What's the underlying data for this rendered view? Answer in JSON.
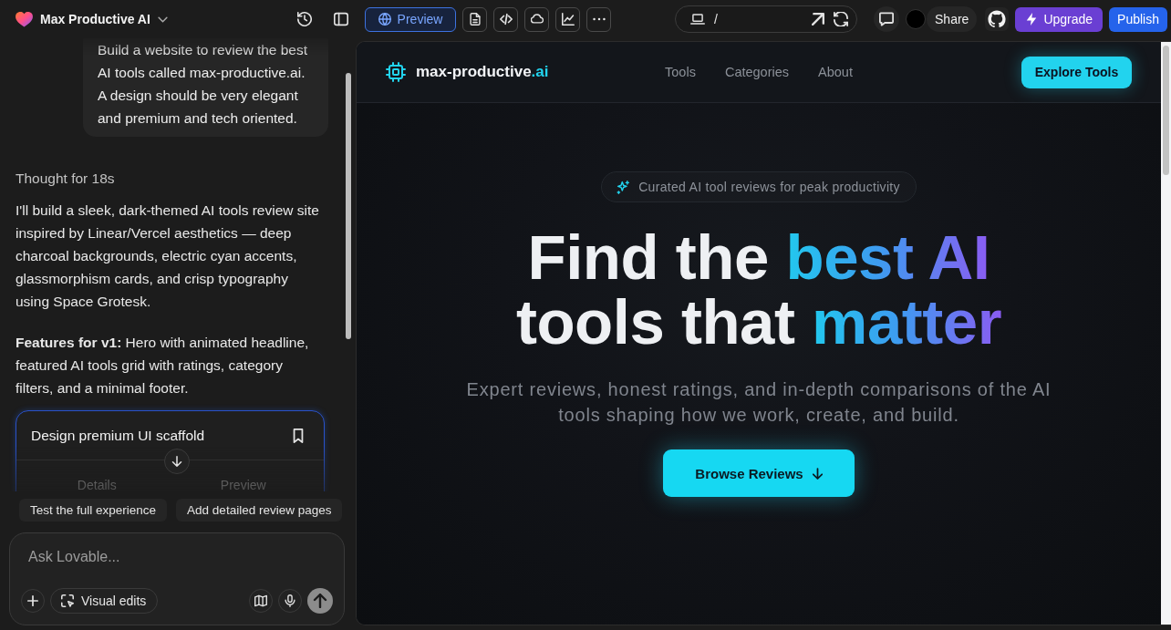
{
  "project": {
    "name": "Max Productive AI"
  },
  "toolbar": {
    "views": [
      {
        "kind": "preview",
        "label": "Preview",
        "selected": true
      },
      {
        "kind": "file",
        "selected": false
      },
      {
        "kind": "code",
        "selected": false
      },
      {
        "kind": "cloud",
        "selected": false
      },
      {
        "kind": "analytics",
        "selected": false
      },
      {
        "kind": "more",
        "selected": false
      }
    ]
  },
  "address_bar": {
    "path": "/"
  },
  "actions": {
    "share": "Share",
    "upgrade": "Upgrade",
    "publish": "Publish"
  },
  "chat": {
    "user_message": "Build a website to review the best AI tools called max-productive.ai. A design should be very elegant and premium and tech oriented.",
    "thought": "Thought for 18s",
    "paragraphs": [
      "I'll build a sleek, dark-themed AI tools review site inspired by Linear/Vercel aesthetics — deep charcoal backgrounds, electric cyan accents, glassmorphism cards, and crisp typography using Space Grotesk.",
      "**Features for v1:** Hero with animated headline, featured AI tools grid with ratings, category filters, and a minimal footer."
    ],
    "plan_card": {
      "title": "Design premium UI scaffold",
      "tabs": [
        "Details",
        "Preview"
      ]
    },
    "suggestions": [
      "Test the full experience",
      "Add detailed review pages"
    ],
    "composer": {
      "placeholder": "Ask Lovable...",
      "visual_edits": "Visual edits"
    }
  },
  "site": {
    "brand": {
      "name": "max-productive",
      "suffix": ".ai"
    },
    "nav": [
      "Tools",
      "Categories",
      "About"
    ],
    "cta": "Explore Tools",
    "badge": "Curated AI tool reviews for peak productivity",
    "headline_lines": [
      {
        "segments": [
          {
            "text": "Find the",
            "accent": false
          },
          {
            "text": "best AI",
            "accent": true
          }
        ]
      },
      {
        "segments": [
          {
            "text": "tools that",
            "accent": false
          },
          {
            "text": "matter",
            "accent": true
          }
        ]
      }
    ],
    "subtitle": "Expert reviews, honest ratings, and in-depth comparisons of the AI tools shaping how we work, create, and build.",
    "primary_button": "Browse Reviews"
  }
}
